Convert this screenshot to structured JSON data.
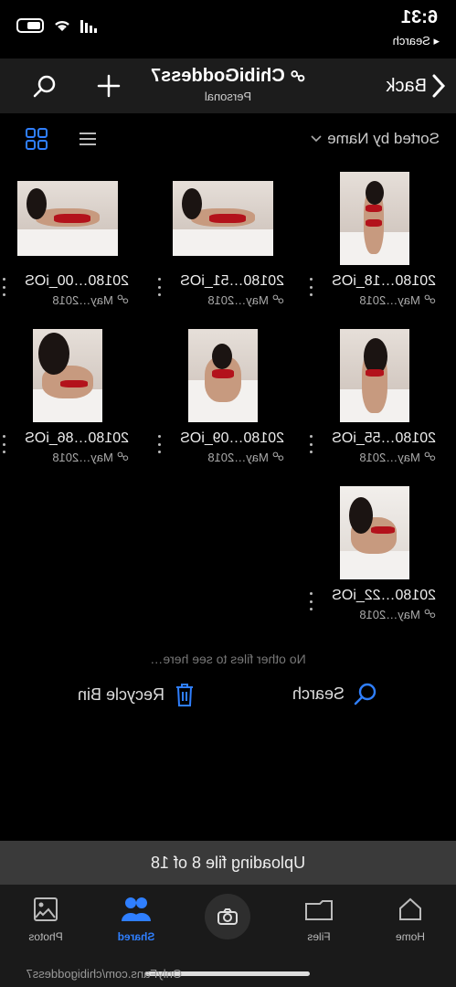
{
  "status": {
    "time": "6:31",
    "back_app": "◂ Search"
  },
  "header": {
    "back_label": "Back",
    "title": "ChibiGoddess7",
    "subtitle": "Personal"
  },
  "sort": {
    "label": "Sorted by Name"
  },
  "files": [
    {
      "name": "20180…18_iOS",
      "meta": "May…2018"
    },
    {
      "name": "20180…51_iOS",
      "meta": "May…2018"
    },
    {
      "name": "20180…00_iOS",
      "meta": "May…2018"
    },
    {
      "name": "20180…55_iOS",
      "meta": "May…2018"
    },
    {
      "name": "20180…09_iOS",
      "meta": "May…2018"
    },
    {
      "name": "20180…86_iOS",
      "meta": "May…2018"
    },
    {
      "name": "20180…22_iOS",
      "meta": "May…2018"
    }
  ],
  "empty_note": "No other files to see here…",
  "actions": {
    "search": "Search",
    "recycle_bin": "Recycle Bin"
  },
  "upload_status": "Uploading file 8 of 18",
  "tabs": {
    "home": "Home",
    "files": "Files",
    "shared": "Shared",
    "photos": "Photos"
  },
  "watermark": "OnlyFans.com/chibigoddess7",
  "colors": {
    "accent": "#2f7fff",
    "background": "#000000",
    "header": "#1c1c1c"
  }
}
